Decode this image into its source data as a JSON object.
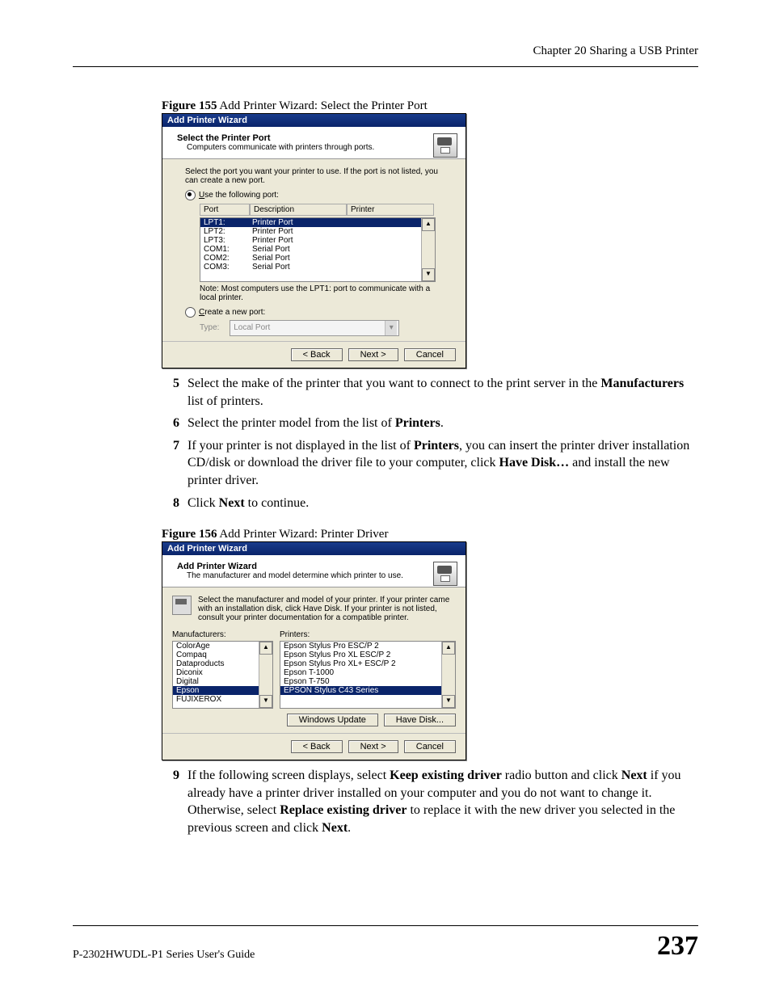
{
  "header": {
    "chapter": "Chapter 20 Sharing a USB Printer"
  },
  "fig155": {
    "caption_bold": "Figure 155",
    "caption_rest": "   Add Printer Wizard: Select the Printer Port",
    "title": "Add Printer Wizard",
    "heading": "Select the Printer Port",
    "subheading": "Computers communicate with printers through ports.",
    "instruct": "Select the port you want your printer to use.  If the port is not listed, you can create a new port.",
    "radio1": "Use the following port:",
    "th_port": "Port",
    "th_desc": "Description",
    "th_printer": "Printer",
    "rows": [
      {
        "port": "LPT1:",
        "desc": "Printer Port",
        "selected": true
      },
      {
        "port": "LPT2:",
        "desc": "Printer Port"
      },
      {
        "port": "LPT3:",
        "desc": "Printer Port"
      },
      {
        "port": "COM1:",
        "desc": "Serial Port"
      },
      {
        "port": "COM2:",
        "desc": "Serial Port"
      },
      {
        "port": "COM3:",
        "desc": "Serial Port"
      }
    ],
    "note": "Note: Most computers use the LPT1: port to communicate with a local printer.",
    "radio2": "Create a new port:",
    "type_label": "Type:",
    "type_value": "Local Port",
    "back": "< Back",
    "next": "Next >",
    "cancel": "Cancel"
  },
  "steps_a": {
    "s5_pre": "Select the make of the printer that you want to connect to the print server in the ",
    "s5_b": "Manufacturers",
    "s5_post": " list of printers.",
    "s6_pre": "Select the printer model from the list of ",
    "s6_b": "Printers",
    "s6_post": ".",
    "s7_pre": "If your printer is not displayed in the list of ",
    "s7_b1": "Printers",
    "s7_mid": ", you can insert the printer driver installation CD/disk or download the driver file to your computer, click ",
    "s7_b2": "Have Disk…",
    "s7_post": " and install the new printer driver.",
    "s8_pre": "Click ",
    "s8_b": "Next",
    "s8_post": " to continue."
  },
  "fig156": {
    "caption_bold": "Figure 156",
    "caption_rest": "   Add Printer Wizard: Printer Driver",
    "title": "Add Printer Wizard",
    "heading": "Add Printer Wizard",
    "subheading": "The manufacturer and model determine which printer to use.",
    "msg": "Select the manufacturer and model of your printer. If your printer came with an installation disk, click Have Disk. If your printer is not listed, consult your printer documentation for a compatible printer.",
    "manu_label": "Manufacturers:",
    "print_label": "Printers:",
    "manufacturers": [
      "ColorAge",
      "Compaq",
      "Dataproducts",
      "Diconix",
      "Digital",
      "Epson",
      "FUJIXEROX"
    ],
    "manu_selected": "Epson",
    "printers": [
      "Epson Stylus Pro ESC/P 2",
      "Epson Stylus Pro XL ESC/P 2",
      "Epson Stylus Pro XL+ ESC/P 2",
      "Epson T-1000",
      "Epson T-750",
      "EPSON Stylus C43 Series"
    ],
    "print_selected": "EPSON Stylus C43 Series",
    "windows_update": "Windows Update",
    "have_disk": "Have Disk...",
    "back": "< Back",
    "next": "Next >",
    "cancel": "Cancel"
  },
  "steps_b": {
    "s9_pre": "If the following screen displays, select ",
    "s9_b1": "Keep existing driver",
    "s9_mid1": " radio button and click ",
    "s9_b2": "Next",
    "s9_mid2": " if you already have a printer driver installed on your computer and you do not want to change it. Otherwise, select ",
    "s9_b3": "Replace existing driver",
    "s9_mid3": " to replace it with the new driver you selected in the previous screen and click ",
    "s9_b4": "Next",
    "s9_post": "."
  },
  "footer": {
    "guide": "P-2302HWUDL-P1 Series User's Guide",
    "page": "237"
  },
  "nums": {
    "n5": "5",
    "n6": "6",
    "n7": "7",
    "n8": "8",
    "n9": "9"
  }
}
